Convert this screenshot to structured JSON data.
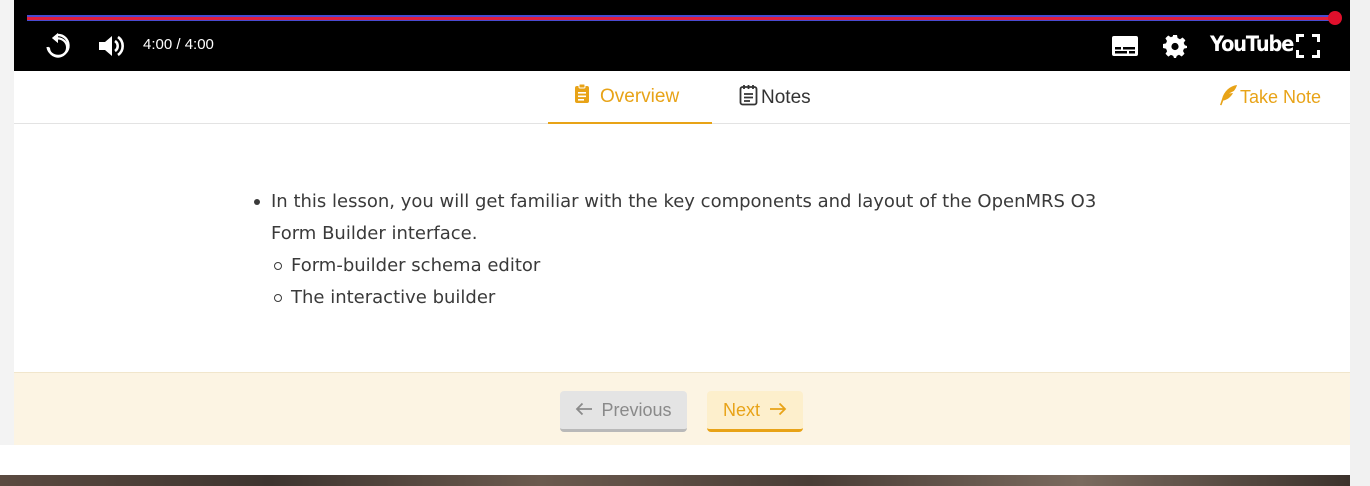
{
  "player": {
    "time_display": "4:00 / 4:00",
    "progress_fraction": 1.0,
    "youtube_label": "YouTube",
    "colors": {
      "background": "#000000",
      "progress": "#e01e3c",
      "track": "#4a4ad0"
    }
  },
  "tabs": [
    {
      "label": "Overview",
      "icon": "clipboard-icon",
      "active": true
    },
    {
      "label": "Notes",
      "icon": "notepad-icon",
      "active": false
    }
  ],
  "take_note": {
    "label": "Take Note",
    "icon": "feather-icon"
  },
  "overview": {
    "bullet_line1": "In this lesson, you will get familiar with the key components and layout of the OpenMRS O3",
    "bullet_line2": "Form Builder interface.",
    "sub_items": [
      "Form-builder schema editor",
      "The interactive builder"
    ]
  },
  "nav": {
    "previous_label": "Previous",
    "next_label": "Next"
  },
  "colors": {
    "accent": "#e8a317",
    "footer_bg": "#fcf4e3"
  }
}
